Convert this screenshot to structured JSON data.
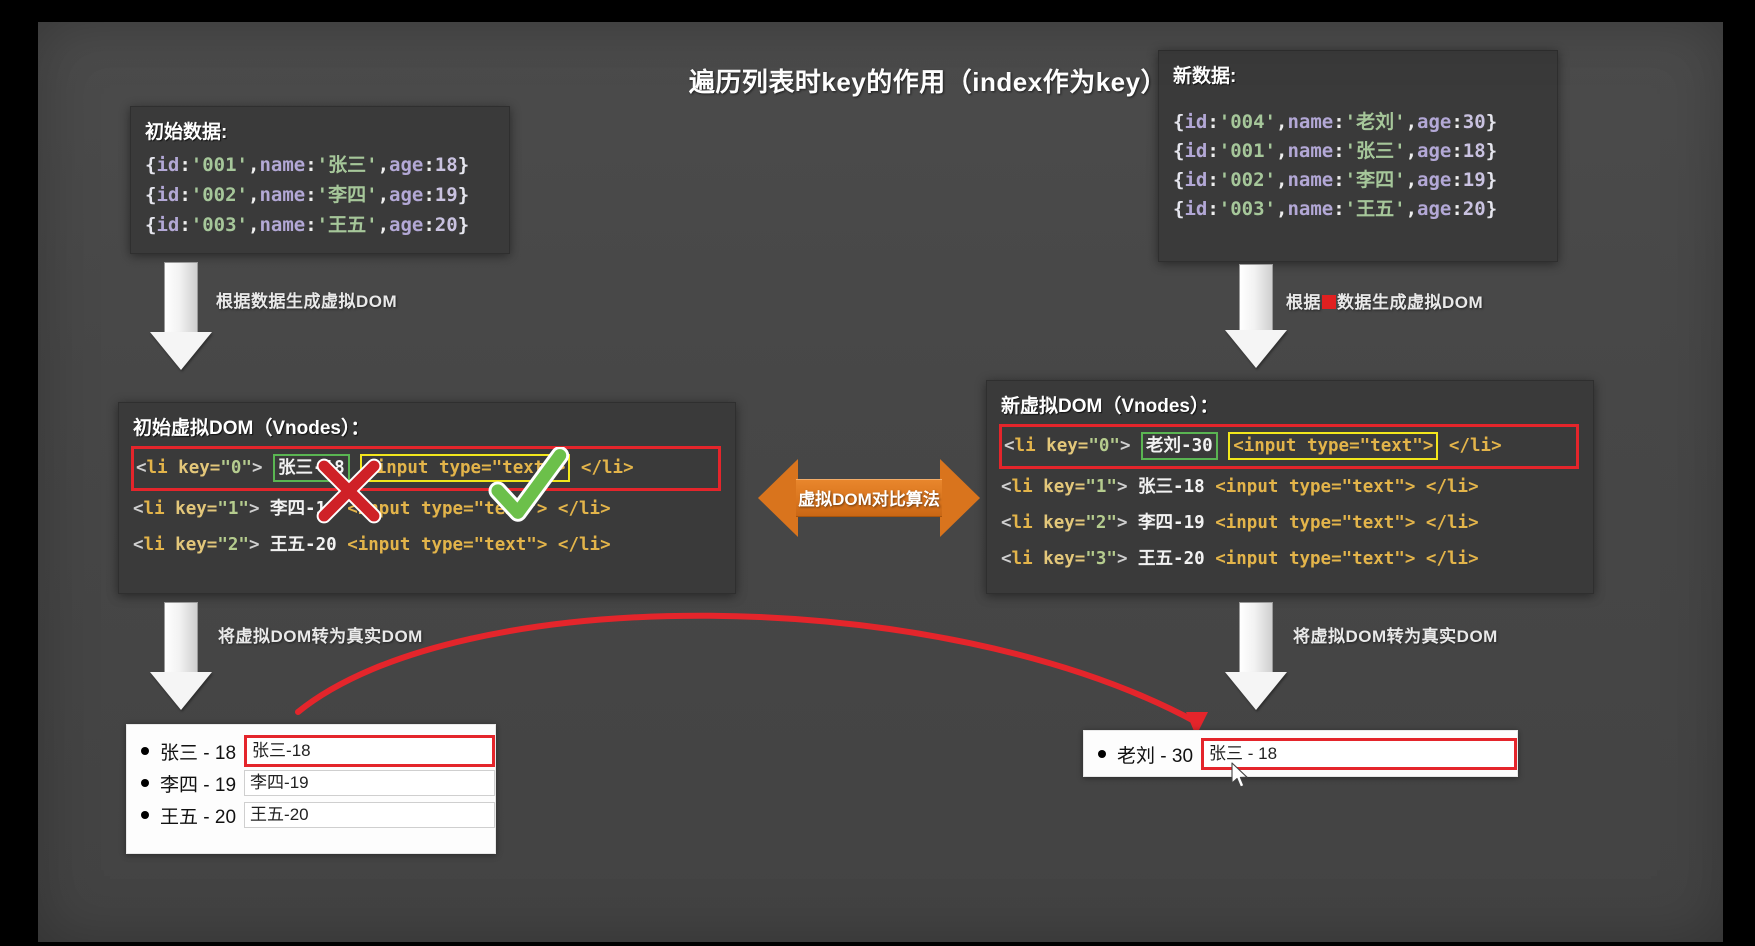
{
  "title": "遍历列表时key的作用（index作为key）",
  "panels": {
    "initial_data": {
      "heading": "初始数据:",
      "rows": [
        {
          "id": "'001'",
          "name": "'张三'",
          "age": "18"
        },
        {
          "id": "'002'",
          "name": "'李四'",
          "age": "19"
        },
        {
          "id": "'003'",
          "name": "'王五'",
          "age": "20"
        }
      ]
    },
    "new_data": {
      "heading": "新数据:",
      "rows": [
        {
          "id": "'004'",
          "name": "'老刘'",
          "age": "30"
        },
        {
          "id": "'001'",
          "name": "'张三'",
          "age": "18"
        },
        {
          "id": "'002'",
          "name": "'李四'",
          "age": "19"
        },
        {
          "id": "'003'",
          "name": "'王五'",
          "age": "20"
        }
      ]
    },
    "old_vdom": {
      "heading": "初始虚拟DOM（Vnodes）：",
      "rows": [
        {
          "key": "\"0\"",
          "text": "张三-18",
          "input": "<input type=\"text\">",
          "close": "</li>"
        },
        {
          "key": "\"1\"",
          "text": "李四-19",
          "input": "<input type=\"text\">",
          "close": "</li>"
        },
        {
          "key": "\"2\"",
          "text": "王五-20",
          "input": "<input type=\"text\">",
          "close": "</li>"
        }
      ]
    },
    "new_vdom": {
      "heading": "新虚拟DOM（Vnodes）：",
      "rows": [
        {
          "key": "\"0\"",
          "text": "老刘-30",
          "input": "<input type=\"text\">",
          "close": "</li>"
        },
        {
          "key": "\"1\"",
          "text": "张三-18",
          "input": "<input type=\"text\">",
          "close": "</li>"
        },
        {
          "key": "\"2\"",
          "text": "李四-19",
          "input": "<input type=\"text\">",
          "close": "</li>"
        },
        {
          "key": "\"3\"",
          "text": "王五-20",
          "input": "<input type=\"text\">",
          "close": "</li>"
        }
      ]
    }
  },
  "captions": {
    "gen_vdom_left": "根据数据生成虚拟DOM",
    "gen_vdom_right_pre": "根据",
    "gen_vdom_right_post": "数据生成虚拟DOM",
    "to_real_dom_left": "将虚拟DOM转为真实DOM",
    "to_real_dom_right": "将虚拟DOM转为真实DOM",
    "diff_algorithm": "虚拟DOM对比算法"
  },
  "results": {
    "left": [
      {
        "label": "张三 - 18",
        "input": "张三-18",
        "highlight": true
      },
      {
        "label": "李四 - 19",
        "input": "李四-19",
        "highlight": false
      },
      {
        "label": "王五 - 20",
        "input": "王五-20",
        "highlight": false
      }
    ],
    "right": [
      {
        "label": "老刘 - 30",
        "input": "张三 - 18",
        "highlight": true
      }
    ]
  },
  "colors": {
    "accent_red": "#e4252b",
    "accent_orange": "#d9741d",
    "accent_green": "#5ab552",
    "accent_yellow": "#f2e61c",
    "panel_bg": "#3a3a3a",
    "slide_bg": "#474747"
  }
}
